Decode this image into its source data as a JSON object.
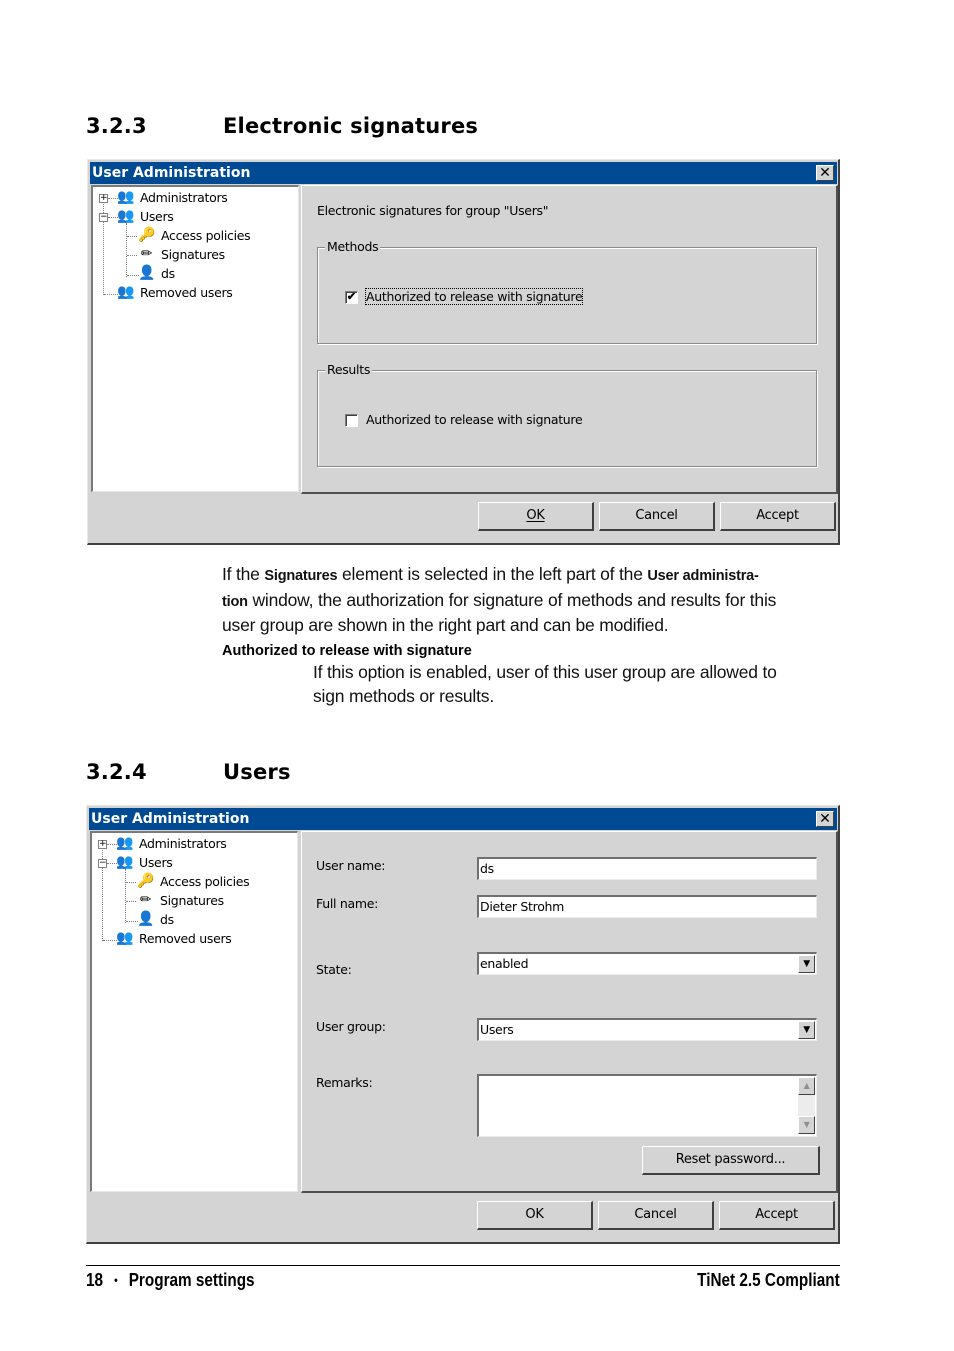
{
  "section1": {
    "number": "3.2.3",
    "title": "Electronic signatures",
    "dialog": {
      "title": "User Administration",
      "close_icon": "close-icon",
      "tree": [
        {
          "label": "Administrators",
          "icon": "user-group-icon",
          "expander": "+"
        },
        {
          "label": "Users",
          "icon": "user-group-icon",
          "expander": "−"
        },
        {
          "label": "Access policies",
          "icon": "key-icon"
        },
        {
          "label": "Signatures",
          "icon": "pencil-icon"
        },
        {
          "label": "ds",
          "icon": "user-icon"
        },
        {
          "label": "Removed users",
          "icon": "user-group-icon"
        }
      ],
      "heading": "Electronic signatures for group \"Users\"",
      "methods_group": {
        "legend": "Methods",
        "checkbox_label": "Authorized to release with signature",
        "checked": true
      },
      "results_group": {
        "legend": "Results",
        "checkbox_label": "Authorized to release with signature",
        "checked": false
      },
      "buttons": {
        "ok": "OK",
        "cancel": "Cancel",
        "accept": "Accept"
      }
    },
    "paragraph": {
      "p1": "If the ",
      "b1": "Signatures",
      "p2": " element is selected in the left part of the ",
      "b2a": "User administra-",
      "b2b": "tion",
      "p3": " window, the authorization for signature of methods and results for this",
      "p4": "user group are shown in the right part and can be modified."
    },
    "term": "Authorized to release with signature",
    "definition_line1": "If this option is enabled, user of this user group are allowed to",
    "definition_line2": "sign methods or results."
  },
  "section2": {
    "number": "3.2.4",
    "title": "Users",
    "dialog": {
      "title": "User Administration",
      "tree": [
        {
          "label": "Administrators",
          "expander": "+"
        },
        {
          "label": "Users",
          "expander": "−"
        },
        {
          "label": "Access policies"
        },
        {
          "label": "Signatures"
        },
        {
          "label": "ds"
        },
        {
          "label": "Removed users"
        }
      ],
      "form": {
        "user_name_label": "User name:",
        "user_name_value": "ds",
        "full_name_label": "Full name:",
        "full_name_value": "Dieter Strohm",
        "state_label": "State:",
        "state_value": "enabled",
        "user_group_label": "User group:",
        "user_group_value": "Users",
        "remarks_label": "Remarks:",
        "remarks_value": ""
      },
      "reset_password": "Reset password...",
      "buttons": {
        "ok": "OK",
        "cancel": "Cancel",
        "accept": "Accept"
      }
    }
  },
  "footer": {
    "page_number": "18",
    "separator": "•",
    "section": "Program settings",
    "product": "TiNet 2.5 Compliant"
  }
}
